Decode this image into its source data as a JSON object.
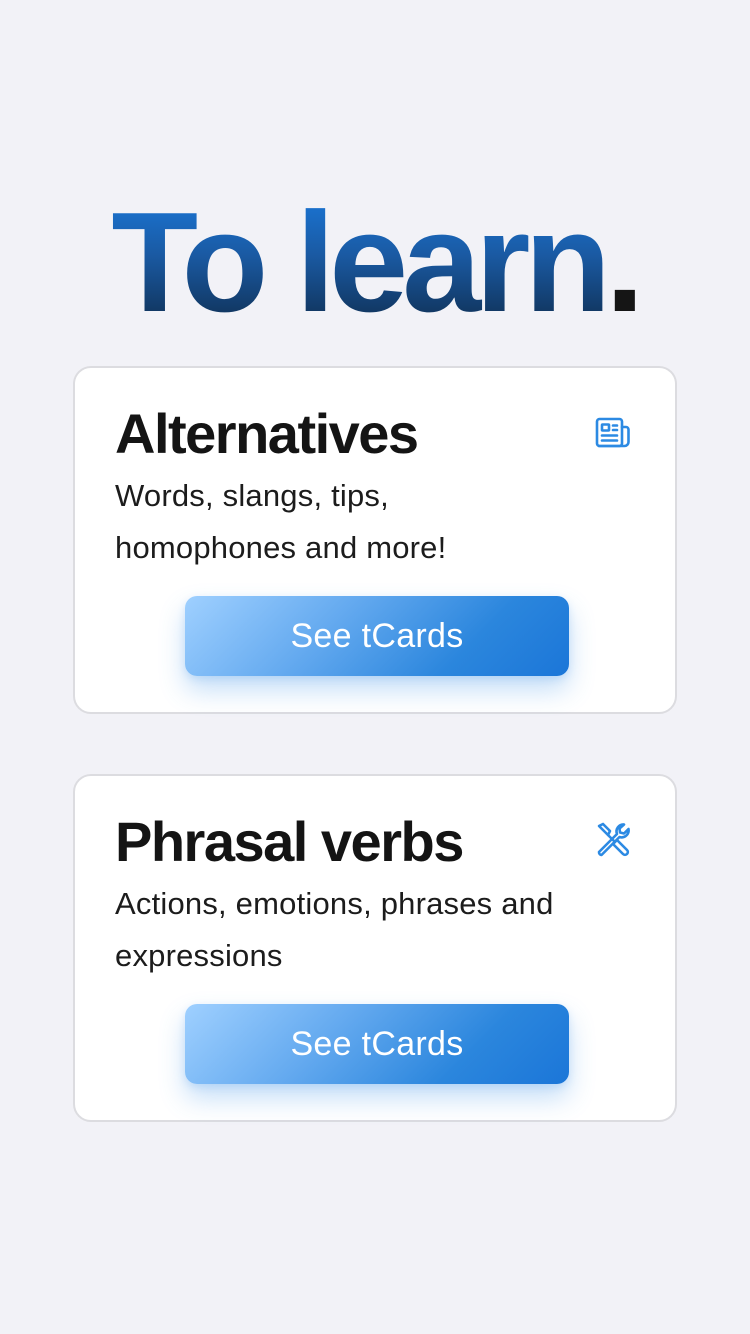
{
  "header": {
    "title": "To learn",
    "title_dot": "."
  },
  "cards": [
    {
      "title": "Alternatives",
      "description": "Words, slangs, tips, homophones and more!",
      "icon": "newspaper-icon",
      "button_label": "See tCards"
    },
    {
      "title": "Phrasal verbs",
      "description": "Actions, emotions, phrases and expressions",
      "icon": "tools-icon",
      "button_label": "See tCards"
    }
  ],
  "colors": {
    "background": "#f2f2f7",
    "accent": "#1b76d8",
    "title_gradient_top": "#1a7be0",
    "title_gradient_bottom": "#0d2744",
    "card_border": "#dcdce0"
  }
}
